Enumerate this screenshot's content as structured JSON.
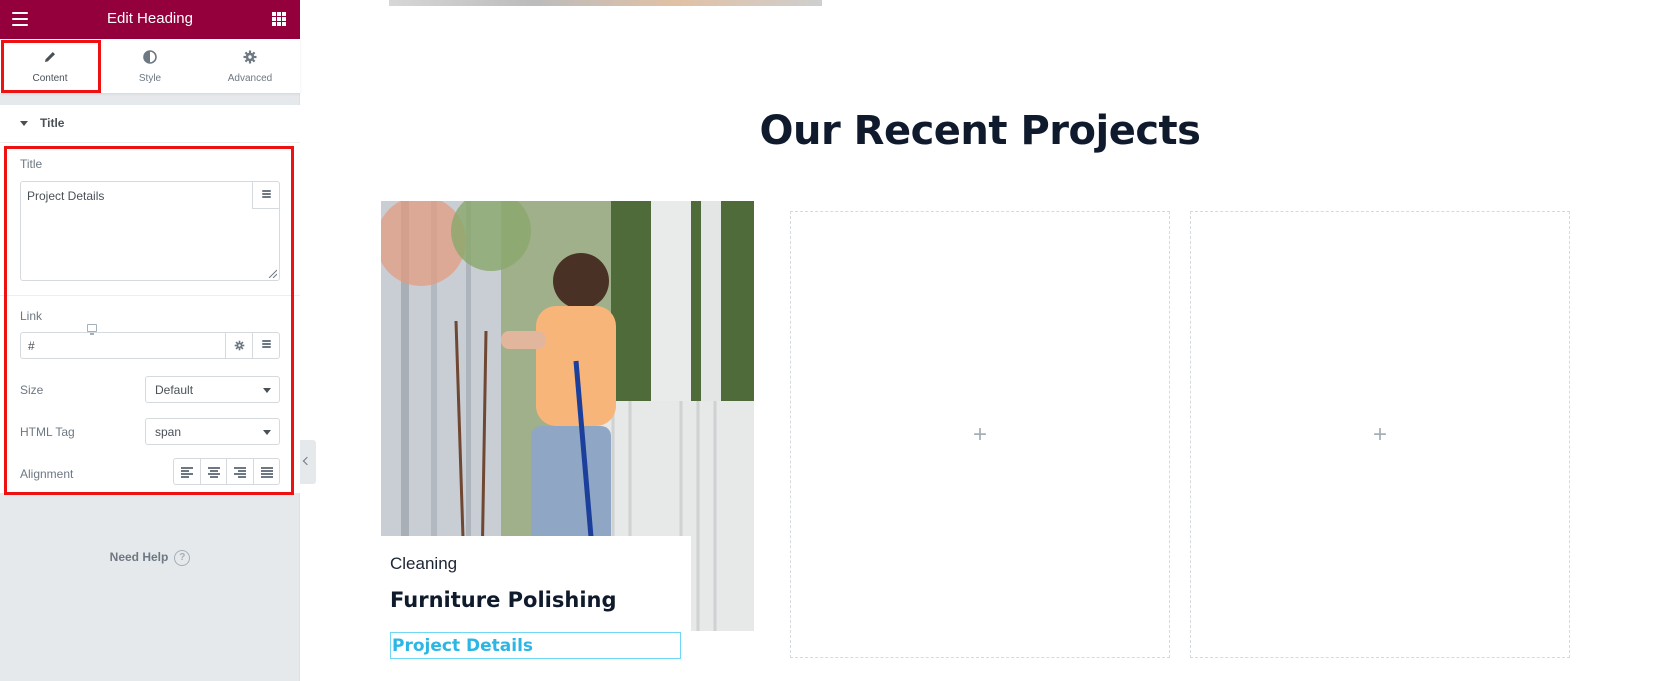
{
  "panel": {
    "title": "Edit Heading",
    "tabs": [
      {
        "label": "Content",
        "icon": "pencil-icon"
      },
      {
        "label": "Style",
        "icon": "contrast-icon"
      },
      {
        "label": "Advanced",
        "icon": "gear-icon"
      }
    ],
    "section": {
      "label": "Title"
    },
    "controls": {
      "title_label": "Title",
      "title_value": "Project Details",
      "link_label": "Link",
      "link_value": "#",
      "size_label": "Size",
      "size_value": "Default",
      "html_tag_label": "HTML Tag",
      "html_tag_value": "span",
      "alignment_label": "Alignment",
      "alignment_options": [
        "align-left-icon",
        "align-center-icon",
        "align-right-icon",
        "align-justify-icon"
      ]
    },
    "help": {
      "label": "Need Help",
      "icon": "?"
    },
    "accent_color": "#93003c",
    "highlight_color": "#ee1111"
  },
  "preview": {
    "section_title": "Our Recent Projects",
    "project": {
      "category": "Cleaning",
      "name": "Furniture Polishing",
      "link_text": "Project Details"
    },
    "placeholder_symbol": "+"
  }
}
